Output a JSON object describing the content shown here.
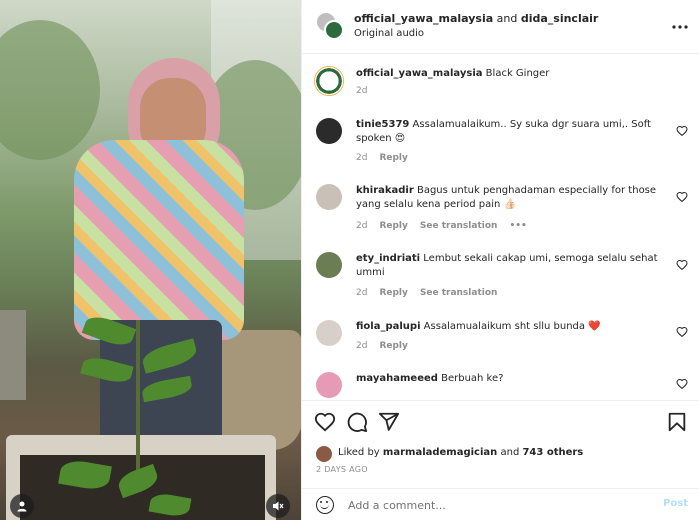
{
  "header": {
    "author": "official_yawa_malaysia",
    "joiner": " and ",
    "coauthor": "dida_sinclair",
    "audio": "Original audio",
    "more_icon": "more-horizontal-icon"
  },
  "caption": {
    "username": "official_yawa_malaysia",
    "text": " Black Ginger",
    "time": "2d"
  },
  "comments": [
    {
      "username": "tinie5379",
      "text": " Assalamualaikum.. Sy suka dgr suara umi,. Soft spoken 😍",
      "time": "2d",
      "reply": "Reply",
      "translate": "",
      "avatar_color": "#2b2b2b"
    },
    {
      "username": "khirakadir",
      "text": " Bagus untuk penghadaman especially for those yang selalu kena period pain 👍🏻",
      "time": "2d",
      "reply": "Reply",
      "translate": "See translation",
      "avatar_color": "#c9c1b8"
    },
    {
      "username": "ety_indriati",
      "text": " Lembut sekali cakap umi, semoga selalu sehat ummi",
      "time": "2d",
      "reply": "Reply",
      "translate": "See translation",
      "avatar_color": "#6b7d52"
    },
    {
      "username": "fiola_palupi",
      "text": " Assalamualaikum sht sllu bunda ❤️",
      "time": "2d",
      "reply": "Reply",
      "translate": "",
      "avatar_color": "#d8d0c8"
    },
    {
      "username": "mayahameeed",
      "text": " Berbuah ke?",
      "time": "",
      "reply": "",
      "translate": "",
      "avatar_color": "#e79ab6"
    }
  ],
  "likes": {
    "prefix": "Liked by ",
    "user": "marmalademagician",
    "middle": " and ",
    "others": "743 others"
  },
  "date": "2 DAYS AGO",
  "add_comment": {
    "placeholder": "Add a comment...",
    "post": "Post"
  },
  "colors": {
    "link_disabled": "#b2dffc",
    "secondary_text": "#8e8e8e",
    "primary_text": "#262626"
  }
}
